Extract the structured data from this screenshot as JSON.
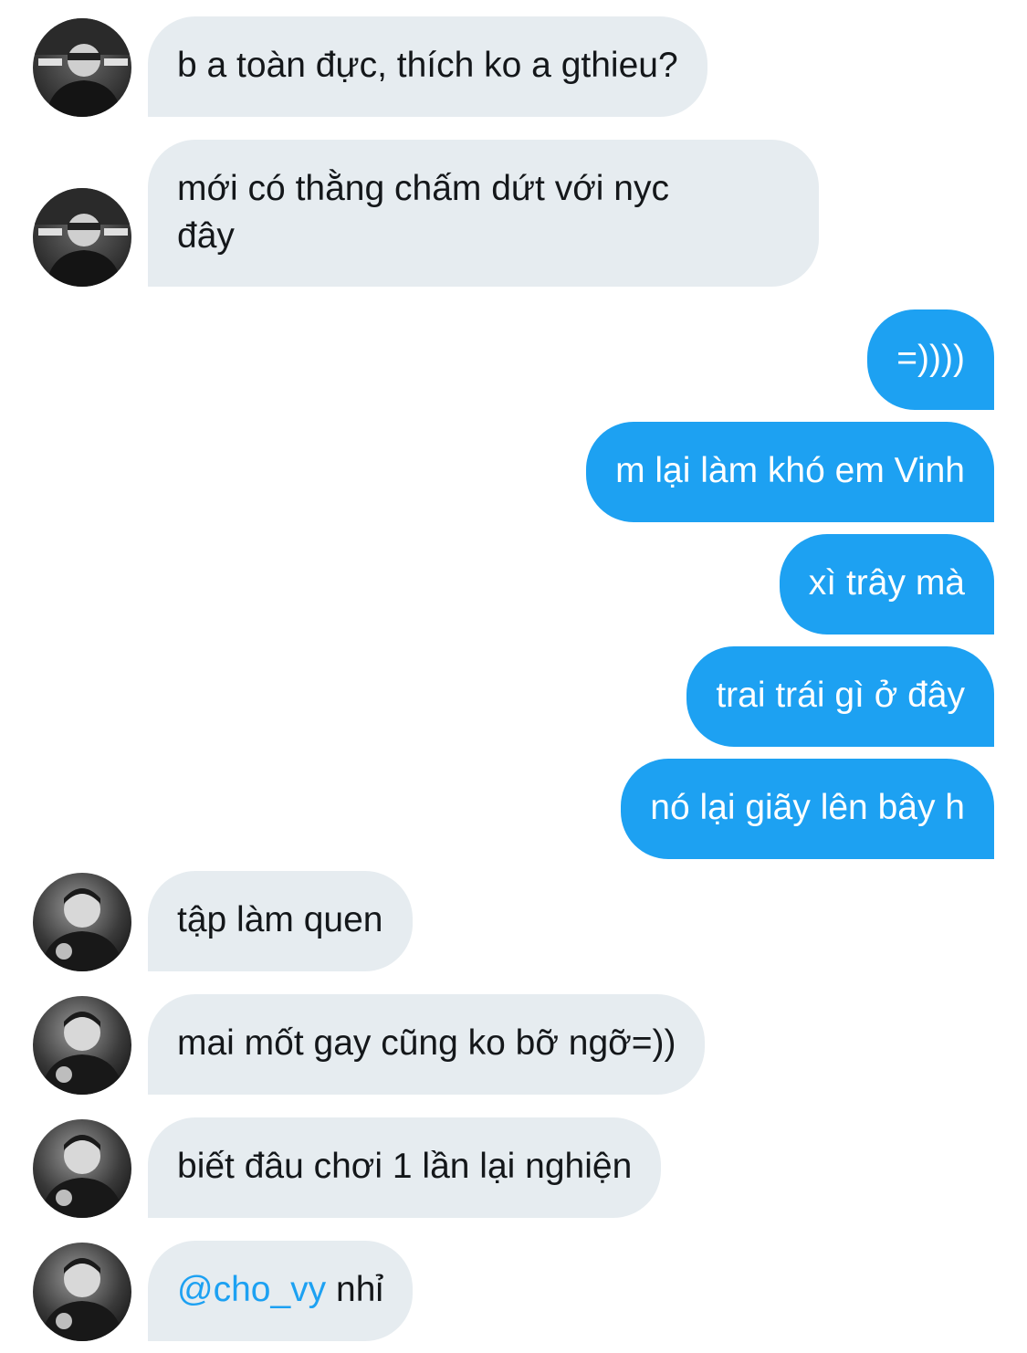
{
  "colors": {
    "incoming_bubble": "#e6ecf0",
    "outgoing_bubble": "#1da1f2",
    "incoming_text": "#14171a",
    "outgoing_text": "#ffffff",
    "mention": "#1da1f2"
  },
  "messages": [
    {
      "direction": "incoming",
      "avatar": "user-a-avatar",
      "text": "b a toàn đực, thích ko a gthieu?"
    },
    {
      "direction": "incoming",
      "avatar": "user-a-avatar",
      "text_line1": "mới có thằng chấm dứt với nyc",
      "text_line2": "đây"
    },
    {
      "direction": "outgoing",
      "text": "=))))"
    },
    {
      "direction": "outgoing",
      "text": "m lại làm khó em Vinh"
    },
    {
      "direction": "outgoing",
      "text": "xì trây mà"
    },
    {
      "direction": "outgoing",
      "text": "trai trái gì ở đây"
    },
    {
      "direction": "outgoing",
      "text": "nó lại giãy lên bây h"
    },
    {
      "direction": "incoming",
      "avatar": "user-b-avatar",
      "text": "tập làm quen"
    },
    {
      "direction": "incoming",
      "avatar": "user-b-avatar",
      "text": "mai mốt gay cũng ko bỡ ngỡ=))"
    },
    {
      "direction": "incoming",
      "avatar": "user-b-avatar",
      "text": "biết đâu chơi 1 lần lại nghiện"
    },
    {
      "direction": "incoming",
      "avatar": "user-b-avatar",
      "mention": "@cho_vy",
      "text": " nhỉ"
    }
  ]
}
